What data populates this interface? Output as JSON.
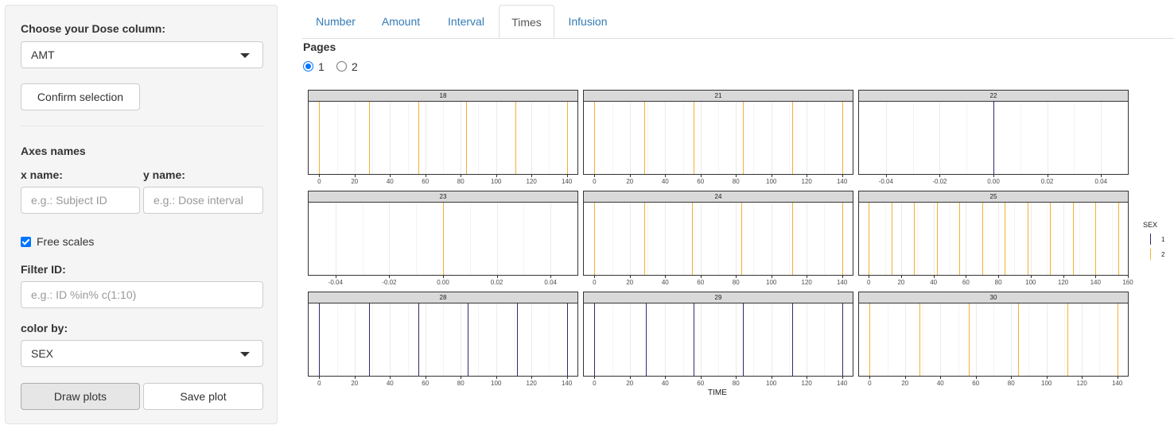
{
  "sidebar": {
    "dose_label": "Choose your Dose column:",
    "dose_value": "AMT",
    "confirm_label": "Confirm selection",
    "axes_title": "Axes names",
    "x_label": "x name:",
    "x_placeholder": "e.g.: Subject ID",
    "y_label": "y name:",
    "y_placeholder": "e.g.: Dose interval",
    "free_scales_label": "Free scales",
    "free_scales_checked": true,
    "filter_label": "Filter ID:",
    "filter_placeholder": "e.g.: ID %in% c(1:10)",
    "color_label": "color by:",
    "color_value": "SEX",
    "draw_label": "Draw plots",
    "save_label": "Save plot"
  },
  "tabs": [
    "Number",
    "Amount",
    "Interval",
    "Times",
    "Infusion"
  ],
  "active_tab": "Times",
  "pages": {
    "title": "Pages",
    "options": [
      "1",
      "2"
    ],
    "selected": "1"
  },
  "chart_data": {
    "type": "facet-vline",
    "xlabel": "TIME",
    "legend": {
      "title": "SEX",
      "entries": [
        {
          "label": "1",
          "color": "#2d2a6e"
        },
        {
          "label": "2",
          "color": "#f2b134"
        }
      ]
    },
    "panels": [
      {
        "id": "18",
        "sex": "2",
        "xlim": [
          -6,
          146
        ],
        "ticks": [
          0,
          20,
          40,
          60,
          80,
          100,
          120,
          140
        ],
        "times": [
          0,
          28,
          56,
          83,
          111,
          140
        ]
      },
      {
        "id": "21",
        "sex": "2",
        "xlim": [
          -6,
          146
        ],
        "ticks": [
          0,
          20,
          40,
          60,
          80,
          100,
          120,
          140
        ],
        "times": [
          0,
          28,
          56,
          84,
          112,
          140
        ]
      },
      {
        "id": "22",
        "sex": "1",
        "xlim": [
          -0.05,
          0.05
        ],
        "ticks": [
          -0.04,
          -0.02,
          0.0,
          0.02,
          0.04
        ],
        "times": [
          0
        ]
      },
      {
        "id": "23",
        "sex": "2",
        "xlim": [
          -0.05,
          0.05
        ],
        "ticks": [
          -0.04,
          -0.02,
          0.0,
          0.02,
          0.04
        ],
        "times": [
          0
        ]
      },
      {
        "id": "24",
        "sex": "2",
        "xlim": [
          -6,
          146
        ],
        "ticks": [
          0,
          20,
          40,
          60,
          80,
          100,
          120,
          140
        ],
        "times": [
          0,
          28,
          55,
          83,
          112,
          140
        ]
      },
      {
        "id": "25",
        "sex": "2",
        "xlim": [
          -6,
          160
        ],
        "ticks": [
          0,
          20,
          40,
          60,
          80,
          100,
          120,
          140,
          160
        ],
        "times": [
          0,
          14,
          28,
          42,
          56,
          70,
          84,
          98,
          112,
          126,
          140,
          154
        ]
      },
      {
        "id": "28",
        "sex": "1",
        "xlim": [
          -6,
          146
        ],
        "ticks": [
          0,
          20,
          40,
          60,
          80,
          100,
          120,
          140
        ],
        "times": [
          0,
          28,
          56,
          84,
          112,
          140
        ]
      },
      {
        "id": "29",
        "sex": "1",
        "xlim": [
          -6,
          146
        ],
        "ticks": [
          0,
          20,
          40,
          60,
          80,
          100,
          120,
          140
        ],
        "times": [
          0,
          29,
          56,
          84,
          112,
          140
        ]
      },
      {
        "id": "30",
        "sex": "2",
        "xlim": [
          -6,
          146
        ],
        "ticks": [
          0,
          20,
          40,
          60,
          80,
          100,
          120,
          140
        ],
        "times": [
          0,
          28,
          56,
          84,
          112,
          140
        ]
      }
    ]
  }
}
